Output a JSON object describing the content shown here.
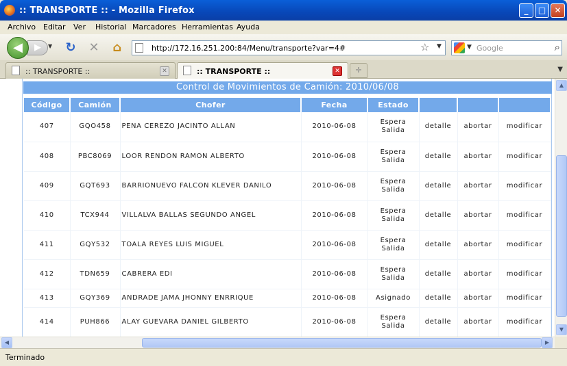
{
  "window": {
    "title": ":: TRANSPORTE :: - Mozilla Firefox"
  },
  "menu": [
    "Archivo",
    "Editar",
    "Ver",
    "Historial",
    "Marcadores",
    "Herramientas",
    "Ayuda"
  ],
  "address": {
    "url": "http://172.16.251.200:84/Menu/transporte?var=4#"
  },
  "search": {
    "engine_icon": "google-icon",
    "placeholder": "Google"
  },
  "tabs": [
    {
      "label": ":: TRANSPORTE ::",
      "active": false
    },
    {
      "label": ":: TRANSPORTE ::",
      "active": true
    }
  ],
  "page": {
    "title": "Control de Movimientos de Camión: 2010/06/08",
    "columns": [
      "Código",
      "Camión",
      "Chofer",
      "Fecha",
      "Estado",
      "",
      "",
      ""
    ],
    "rows": [
      {
        "codigo": "407",
        "camion": "GQO458",
        "chofer": "PENA CEREZO JACINTO ALLAN",
        "fecha": "2010-06-08",
        "estado": [
          "Espera",
          "Salida"
        ],
        "a1": "detalle",
        "a2": "abortar",
        "a3": "modificar"
      },
      {
        "codigo": "408",
        "camion": "PBC8069",
        "chofer": "LOOR RENDON RAMON ALBERTO",
        "fecha": "2010-06-08",
        "estado": [
          "Espera",
          "Salida"
        ],
        "a1": "detalle",
        "a2": "abortar",
        "a3": "modificar"
      },
      {
        "codigo": "409",
        "camion": "GQT693",
        "chofer": "BARRIONUEVO FALCON KLEVER DANILO",
        "fecha": "2010-06-08",
        "estado": [
          "Espera",
          "Salida"
        ],
        "a1": "detalle",
        "a2": "abortar",
        "a3": "modificar"
      },
      {
        "codigo": "410",
        "camion": "TCX944",
        "chofer": "VILLALVA BALLAS SEGUNDO ANGEL",
        "fecha": "2010-06-08",
        "estado": [
          "Espera",
          "Salida"
        ],
        "a1": "detalle",
        "a2": "abortar",
        "a3": "modificar"
      },
      {
        "codigo": "411",
        "camion": "GQY532",
        "chofer": "TOALA REYES LUIS MIGUEL",
        "fecha": "2010-06-08",
        "estado": [
          "Espera",
          "Salida"
        ],
        "a1": "detalle",
        "a2": "abortar",
        "a3": "modificar"
      },
      {
        "codigo": "412",
        "camion": "TDN659",
        "chofer": "CABRERA EDI",
        "fecha": "2010-06-08",
        "estado": [
          "Espera",
          "Salida"
        ],
        "a1": "detalle",
        "a2": "abortar",
        "a3": "modificar"
      },
      {
        "codigo": "413",
        "camion": "GQY369",
        "chofer": "ANDRADE JAMA JHONNY ENRRIQUE",
        "fecha": "2010-06-08",
        "estado": [
          "Asignado"
        ],
        "a1": "detalle",
        "a2": "abortar",
        "a3": "modificar"
      },
      {
        "codigo": "414",
        "camion": "PUH866",
        "chofer": "ALAY GUEVARA DANIEL GILBERTO",
        "fecha": "2010-06-08",
        "estado": [
          "Espera",
          "Salida"
        ],
        "a1": "detalle",
        "a2": "abortar",
        "a3": "modificar"
      }
    ]
  },
  "status": {
    "text": "Terminado"
  },
  "colors": {
    "header_blue": "#73a9ea",
    "titlebar_blue": "#0a5fd8"
  }
}
